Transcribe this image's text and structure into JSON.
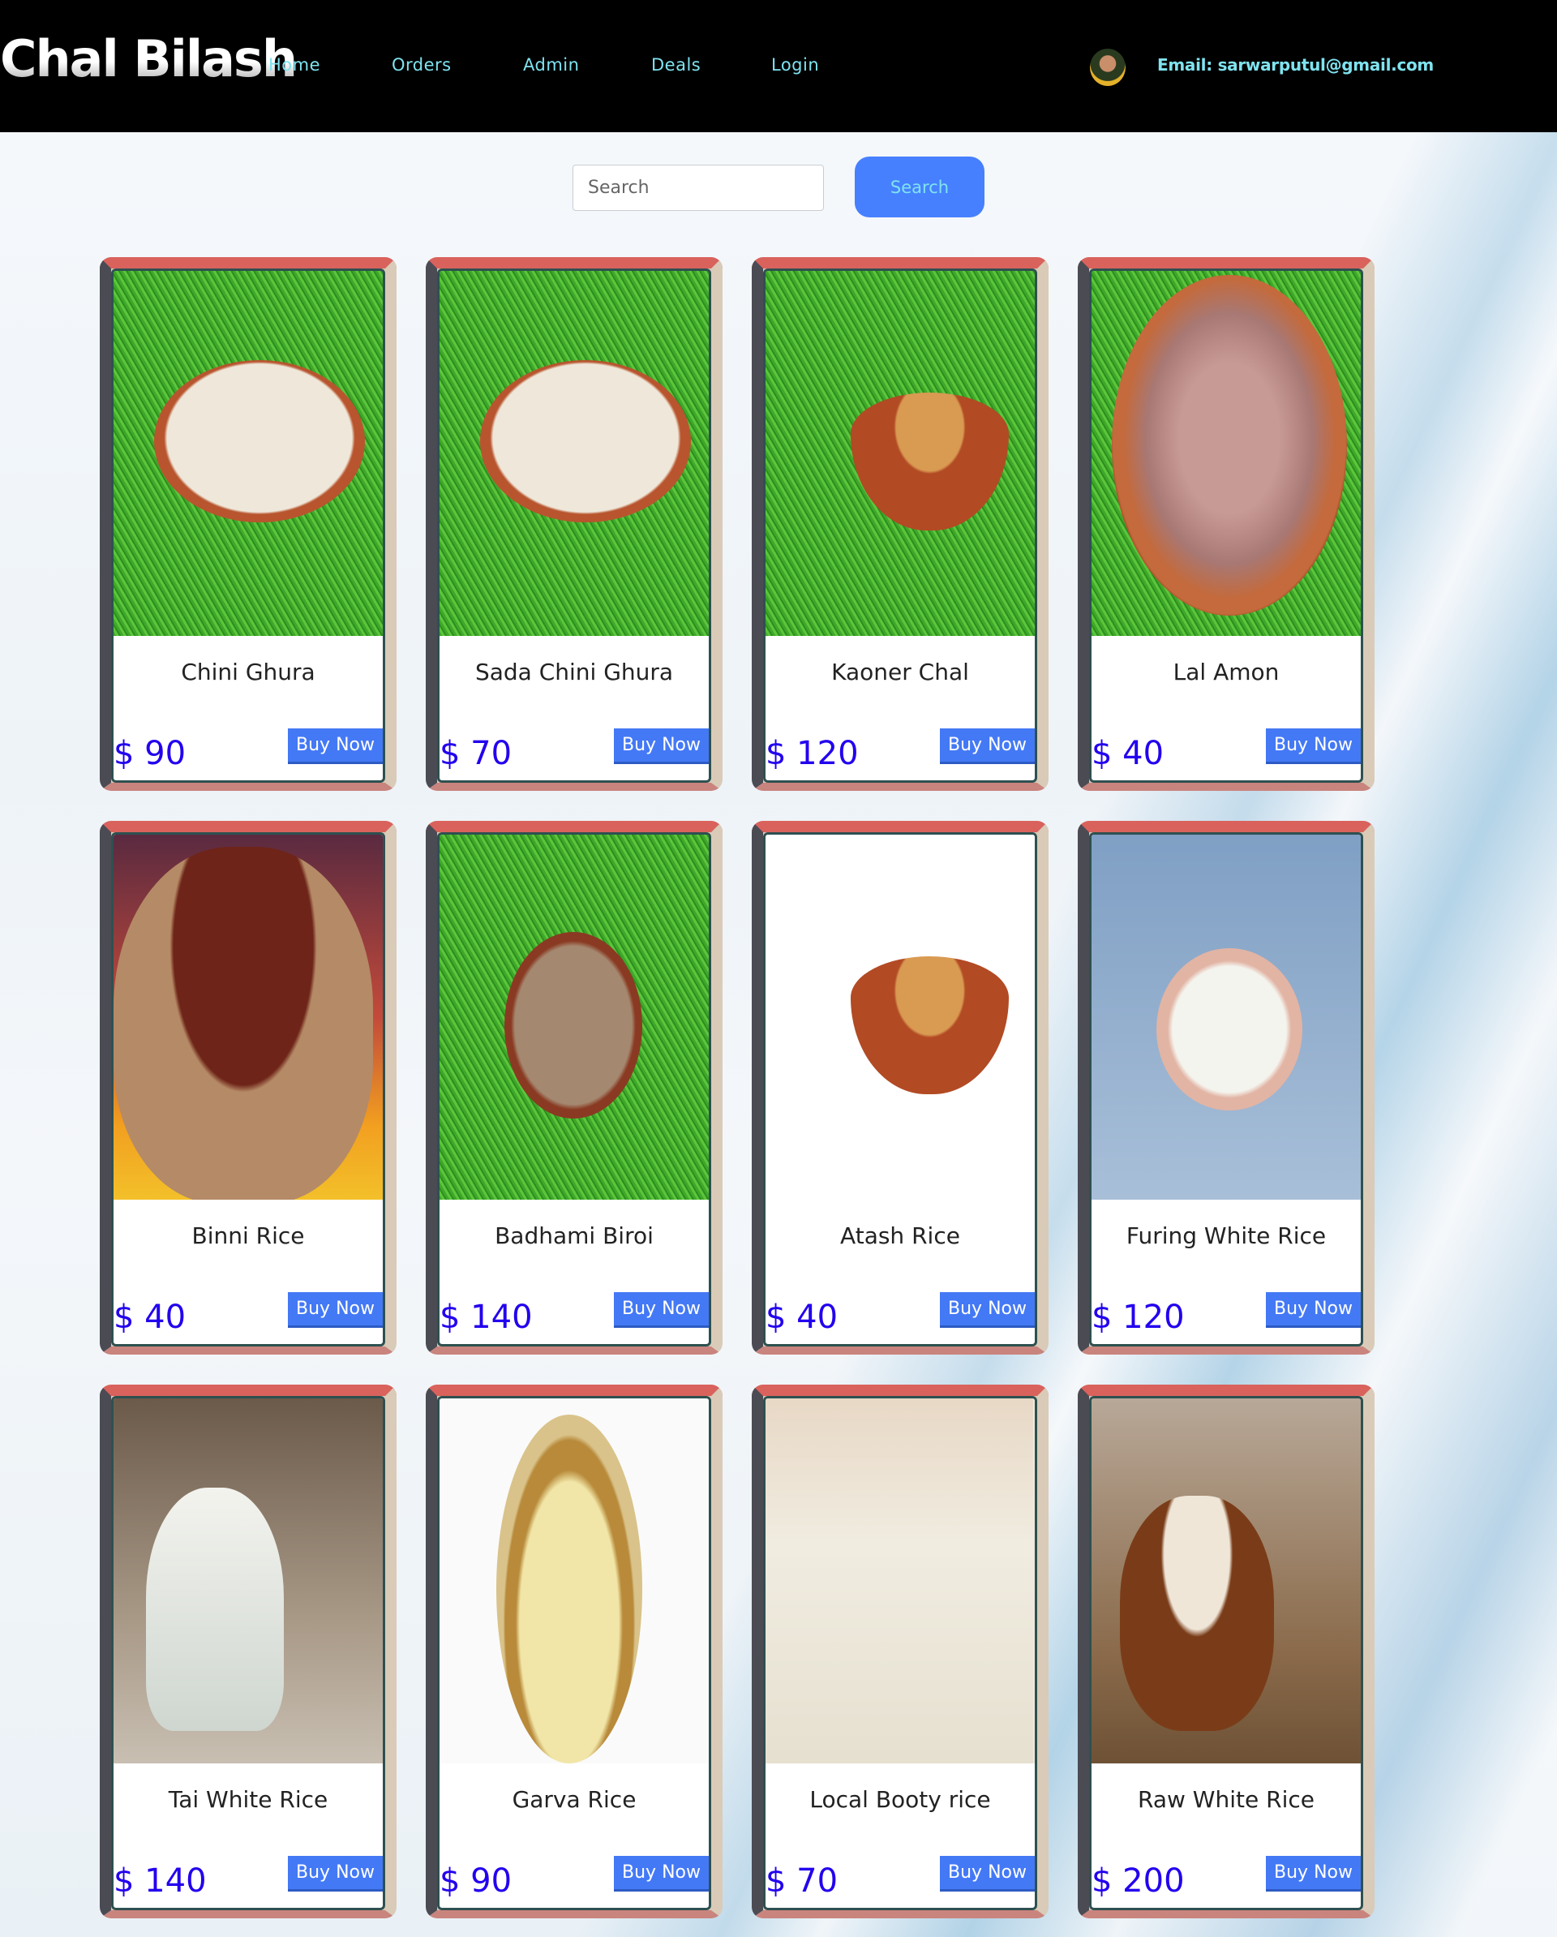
{
  "header": {
    "logo": "Chal Bilash",
    "nav": [
      "Home",
      "Orders",
      "Admin",
      "Deals",
      "Login"
    ],
    "email": "Email: sarwarputul@gmail.com"
  },
  "search": {
    "placeholder": "Search",
    "value": "",
    "button_label": "Search"
  },
  "products": [
    {
      "name": "Chini Ghura",
      "price": "$ 90",
      "button": "Buy Now",
      "image": "grass-clay-plate-white-rice"
    },
    {
      "name": "Sada Chini Ghura",
      "price": "$ 70",
      "button": "Buy Now",
      "image": "grass-clay-plate-white-rice"
    },
    {
      "name": "Kaoner Chal",
      "price": "$ 120",
      "button": "Buy Now",
      "image": "grass-clay-bowl-millet"
    },
    {
      "name": "Lal Amon",
      "price": "$ 40",
      "button": "Buy Now",
      "image": "grass-clay-plate-red-rice"
    },
    {
      "name": "Binni Rice",
      "price": "$ 40",
      "button": "Buy Now",
      "image": "wooden-bowl-red-rice-sunset"
    },
    {
      "name": "Badhami Biroi",
      "price": "$ 140",
      "button": "Buy Now",
      "image": "grass-clay-plate-brown-rice"
    },
    {
      "name": "Atash Rice",
      "price": "$ 40",
      "button": "Buy Now",
      "image": "clay-bowl-millet-white"
    },
    {
      "name": "Furing White Rice",
      "price": "$ 120",
      "button": "Buy Now",
      "image": "hands-white-rice"
    },
    {
      "name": "Tai White Rice",
      "price": "$ 140",
      "button": "Buy Now",
      "image": "glass-white-rice"
    },
    {
      "name": "Garva Rice",
      "price": "$ 90",
      "button": "Buy Now",
      "image": "basket-rice-paddy"
    },
    {
      "name": "Local Booty rice",
      "price": "$ 70",
      "button": "Buy Now",
      "image": "hand-pouring-rice"
    },
    {
      "name": "Raw White Rice",
      "price": "$ 200",
      "button": "Buy Now",
      "image": "wooden-bowl-white-rice"
    }
  ]
}
